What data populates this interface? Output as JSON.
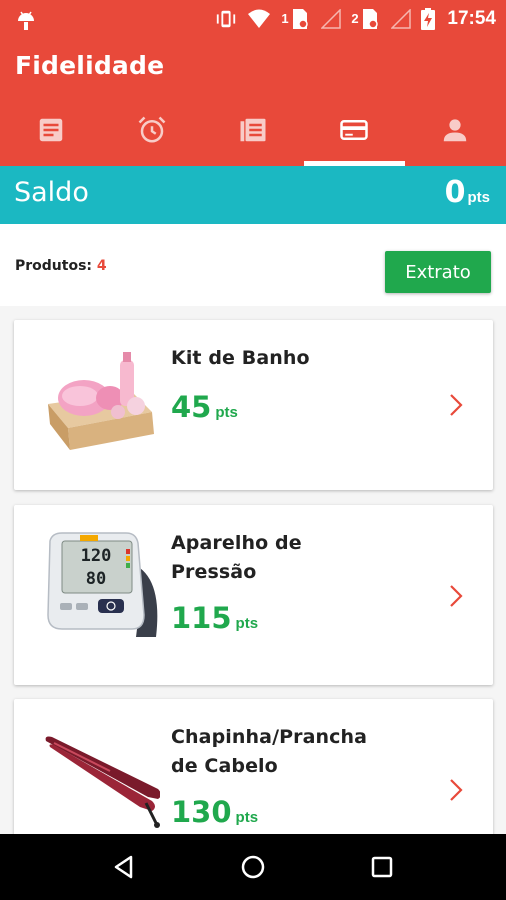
{
  "status_bar": {
    "time": "17:54",
    "sim1_label": "1",
    "sim2_label": "2",
    "icons": [
      "android-icon",
      "vibrate-icon",
      "wifi-icon",
      "sim-icon",
      "signal-icon",
      "battery-charging-icon"
    ]
  },
  "app": {
    "title": "Fidelidade",
    "tabs": [
      {
        "icon": "document-icon",
        "active": false
      },
      {
        "icon": "alarm-icon",
        "active": false
      },
      {
        "icon": "list-icon",
        "active": false
      },
      {
        "icon": "card-icon",
        "active": true
      },
      {
        "icon": "person-icon",
        "active": false
      }
    ]
  },
  "saldo": {
    "label": "Saldo",
    "value": "0",
    "unit": "pts"
  },
  "produtos": {
    "label": "Produtos:",
    "count": "4"
  },
  "extrato_label": "Extrato",
  "products": [
    {
      "name": "Kit de Banho",
      "points": "45",
      "unit": "pts",
      "image": "bath-kit-image"
    },
    {
      "name": "Aparelho de Pressão",
      "points": "115",
      "unit": "pts",
      "image": "blood-pressure-monitor-image"
    },
    {
      "name": "Chapinha/Prancha de Cabelo",
      "points": "130",
      "unit": "pts",
      "image": "hair-straightener-image"
    }
  ],
  "colors": {
    "primary": "#e8493a",
    "saldo_bar": "#1bb8c2",
    "green": "#20a84d"
  },
  "nav_bar": [
    "back-icon",
    "home-icon",
    "recents-icon"
  ]
}
